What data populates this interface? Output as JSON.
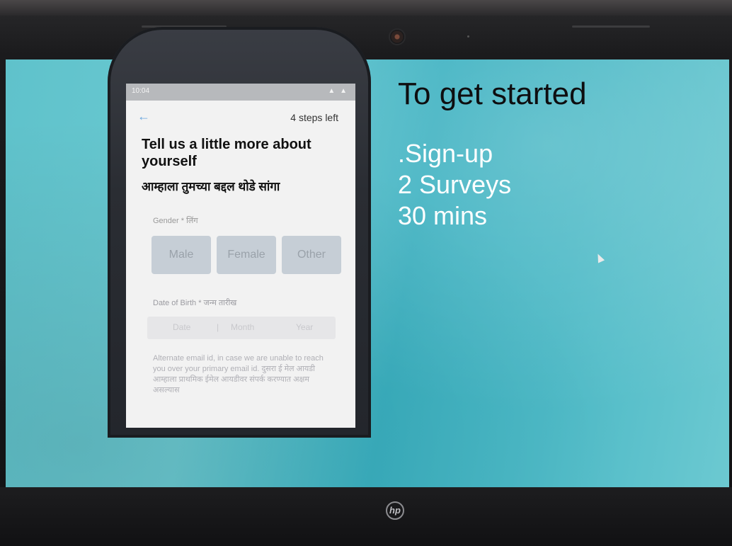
{
  "slide": {
    "headline": "To get started",
    "bullets": [
      ".Sign-up",
      "2 Surveys",
      "30 mins"
    ]
  },
  "phone": {
    "status_time": "10:04",
    "status_icons": "▲ ▲",
    "back_icon": "back-arrow-icon",
    "steps_left": "4 steps left",
    "title": "Tell us a little more about yourself",
    "subtitle": "आम्हाला तुमच्या बद्दल थोडे सांगा",
    "gender_label": "Gender * लिंग",
    "gender_options": [
      "Male",
      "Female",
      "Other"
    ],
    "dob_label": "Date of Birth * जन्म तारीख",
    "dob_fields": [
      "Date",
      "Month",
      "Year"
    ],
    "alt_email": "Alternate email id, in case we are unable to reach you over your primary email id. दुसरा ई मेल आयडी आम्हाला प्राथमिक ईमेल आयडीवर संपर्क करण्यात अक्षम असल्यास"
  },
  "device": {
    "brand": "hp"
  }
}
